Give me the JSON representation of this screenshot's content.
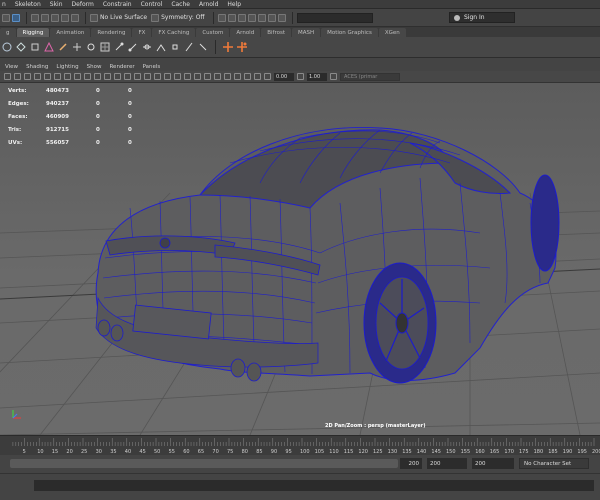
{
  "menu": {
    "items": [
      "n",
      "Skeleton",
      "Skin",
      "Deform",
      "Constrain",
      "Control",
      "Cache",
      "Arnold",
      "Help"
    ]
  },
  "statusline": {
    "live_surface": "No Live Surface",
    "symmetry": "Symmetry: Off",
    "signin": "Sign In"
  },
  "shelf_tabs": [
    {
      "label": "g",
      "active": false
    },
    {
      "label": "Rigging",
      "active": true
    },
    {
      "label": "Animation",
      "active": false
    },
    {
      "label": "Rendering",
      "active": false
    },
    {
      "label": "FX",
      "active": false
    },
    {
      "label": "FX Caching",
      "active": false
    },
    {
      "label": "Custom",
      "active": false
    },
    {
      "label": "Arnold",
      "active": false
    },
    {
      "label": "Bifrost",
      "active": false
    },
    {
      "label": "MASH",
      "active": false
    },
    {
      "label": "Motion Graphics",
      "active": false
    },
    {
      "label": "XGen",
      "active": false
    }
  ],
  "panel_menu": [
    "View",
    "Shading",
    "Lighting",
    "Show",
    "Renderer",
    "Panels"
  ],
  "panel_toolbar": {
    "field_a": "0.00",
    "field_b": "1.00",
    "colorspace": "ACES (primar"
  },
  "hud": [
    {
      "label": "Verts:",
      "v1": "480473",
      "v2": "0",
      "v3": "0"
    },
    {
      "label": "Edges:",
      "v1": "940237",
      "v2": "0",
      "v3": "0"
    },
    {
      "label": "Faces:",
      "v1": "460909",
      "v2": "0",
      "v3": "0"
    },
    {
      "label": "Tris:",
      "v1": "912715",
      "v2": "0",
      "v3": "0"
    },
    {
      "label": "UVs:",
      "v1": "556057",
      "v2": "0",
      "v3": "0"
    }
  ],
  "viewport": {
    "camera_label": "2D Pan/Zoom : persp (masterLayer)",
    "wire_color": "#1c1ccc",
    "grid_color": "#545454"
  },
  "timeline": {
    "ticks": [
      "5",
      "10",
      "15",
      "20",
      "25",
      "30",
      "35",
      "40",
      "45",
      "50",
      "55",
      "60",
      "65",
      "70",
      "75",
      "80",
      "85",
      "90",
      "95",
      "100",
      "105",
      "110",
      "115",
      "120",
      "125",
      "130",
      "135",
      "140",
      "145",
      "150",
      "155",
      "160",
      "165",
      "170",
      "175",
      "180",
      "185",
      "190",
      "195",
      "200"
    ]
  },
  "range": {
    "range_end": "200",
    "anim_end": "200",
    "playback_end": "200",
    "character_set": "No Character Set"
  }
}
